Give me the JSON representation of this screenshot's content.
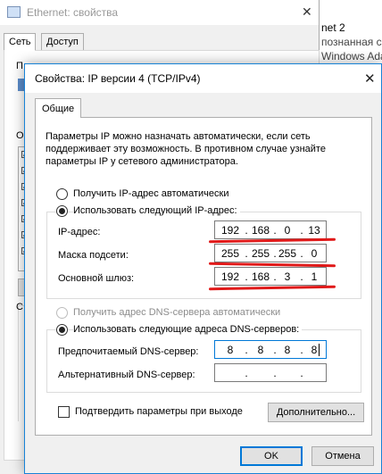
{
  "bg_window": {
    "title": "Ethernet: свойства",
    "tabs": [
      "Сеть",
      "Доступ"
    ],
    "fragments": [
      "П",
      "О",
      "С"
    ]
  },
  "right_window": {
    "lines": [
      "net 2",
      "познанная се",
      "Windows Ada"
    ]
  },
  "dialog": {
    "title": "Свойства: IP версии 4 (TCP/IPv4)",
    "close_glyph": "✕",
    "tab": "Общие",
    "description": "Параметры IP можно назначать автоматически, если сеть поддерживает эту возможность. В противном случае узнайте параметры IP у сетевого администратора.",
    "ip_auto_label": "Получить IP-адрес автоматически",
    "ip_manual_label": "Использовать следующий IP-адрес:",
    "ip_fields": [
      {
        "label": "IP-адрес:",
        "octets": [
          "192",
          "168",
          "0",
          "13"
        ]
      },
      {
        "label": "Маска подсети:",
        "octets": [
          "255",
          "255",
          "255",
          "0"
        ]
      },
      {
        "label": "Основной шлюз:",
        "octets": [
          "192",
          "168",
          "3",
          "1"
        ]
      }
    ],
    "dns_auto_label": "Получить адрес DNS-сервера автоматически",
    "dns_manual_label": "Использовать следующие адреса DNS-серверов:",
    "dns_fields": [
      {
        "label": "Предпочитаемый DNS-сервер:",
        "octets": [
          "8",
          "8",
          "8",
          "8"
        ]
      },
      {
        "label": "Альтернативный DNS-сервер:",
        "octets": [
          "",
          "",
          "",
          ""
        ]
      }
    ],
    "validate_label": "Подтвердить параметры при выходе",
    "advanced_label": "Дополнительно...",
    "ok_label": "OK",
    "cancel_label": "Отмена",
    "dot": ".",
    "selected_ip_mode": "manual",
    "selected_dns_mode": "manual",
    "annotation_color": "#e01919"
  }
}
